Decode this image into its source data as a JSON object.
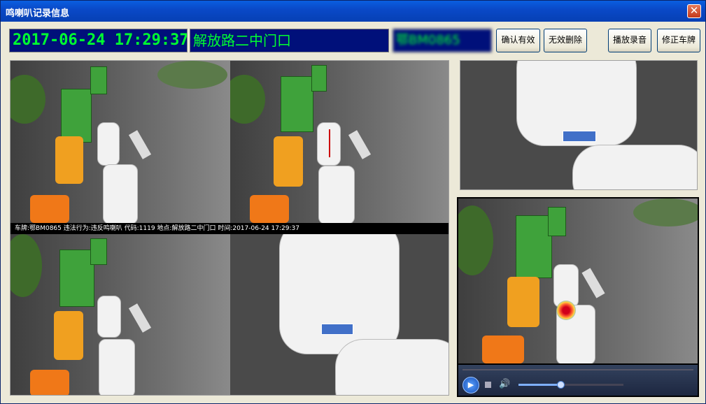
{
  "window": {
    "title": "鸣喇叭记录信息",
    "close_glyph": "✕"
  },
  "header": {
    "datetime": "2017-06-24 17:29:37",
    "location": "解放路二中门口",
    "plate": "鄂BM0865"
  },
  "buttons": {
    "confirm_valid": "确认有效",
    "invalid_delete": "无效删除",
    "play_audio": "播放录音",
    "fix_plate": "修正车牌"
  },
  "overlay": {
    "info_text": "车牌:鄂BM0865 违法行为:违反鸣喇叭 代码:1119 地点:解放路二中门口 时间:2017-06-24 17:29:37"
  },
  "player": {
    "play_glyph": "▶",
    "volume_glyph": "🔊",
    "progress": 0.4
  },
  "icons": [
    "close-icon",
    "play-icon",
    "stop-icon",
    "volume-icon"
  ]
}
